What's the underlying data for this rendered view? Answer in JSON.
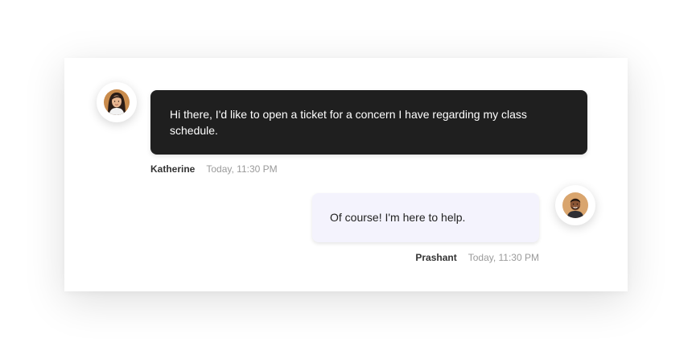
{
  "messages": [
    {
      "sender": "Katherine",
      "time": "Today, 11:30 PM",
      "text": "Hi there, I'd like to open a ticket for a concern I have regarding my class schedule.",
      "avatar_icon": "woman-avatar-icon",
      "bubble_color": "#1f1f1f"
    },
    {
      "sender": "Prashant",
      "time": "Today, 11:30 PM",
      "text": "Of course! I'm here to help.",
      "avatar_icon": "man-avatar-icon",
      "bubble_color": "#f4f3fd"
    }
  ]
}
